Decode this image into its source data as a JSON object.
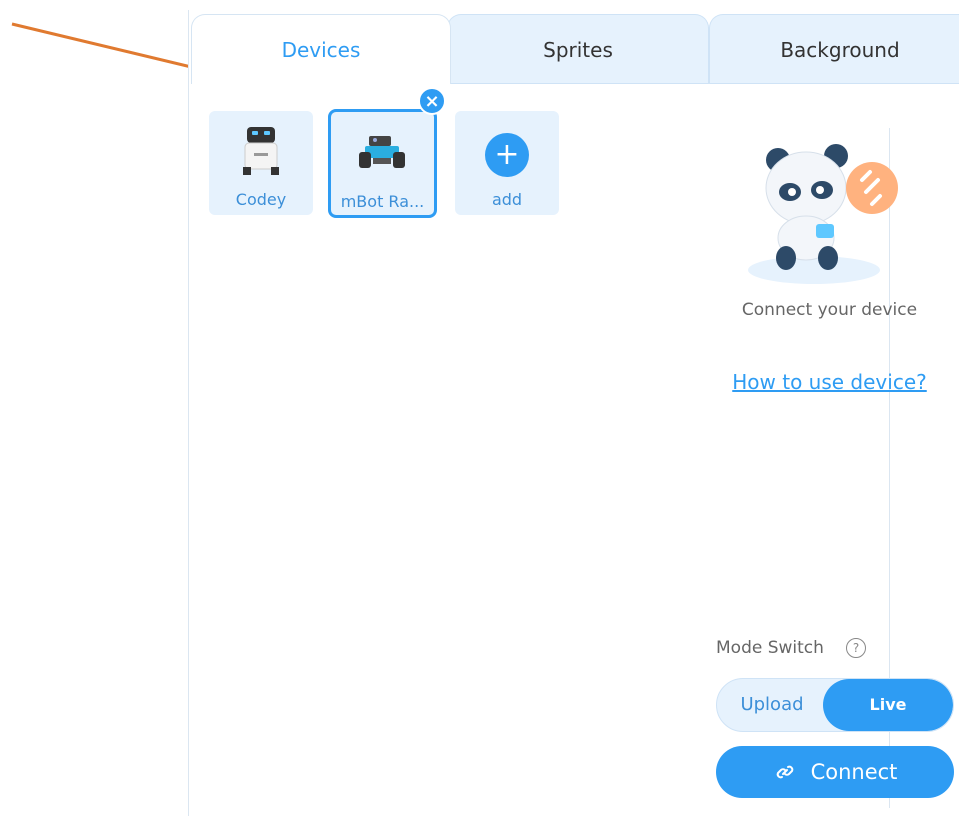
{
  "tabs": [
    {
      "label": "Devices",
      "active": true
    },
    {
      "label": "Sprites",
      "active": false
    },
    {
      "label": "Background",
      "active": false
    }
  ],
  "devices": [
    {
      "label": "Codey",
      "icon": "codey-robot-icon"
    },
    {
      "label": "mBot Ra...",
      "icon": "mbot-ranger-robot-icon",
      "selected": true
    },
    {
      "label": "add",
      "icon": "plus-icon"
    }
  ],
  "side": {
    "connect_text": "Connect your device",
    "howto_link": "How to use device?",
    "mode_label": "Mode Switch",
    "mode_help": "?",
    "upload_label": "Upload",
    "live_label": "Live",
    "connect_label": "Connect"
  },
  "colors": {
    "accent": "#2e9cf3",
    "card_bg": "#e6f2fd",
    "arrow": "#e07a30"
  }
}
